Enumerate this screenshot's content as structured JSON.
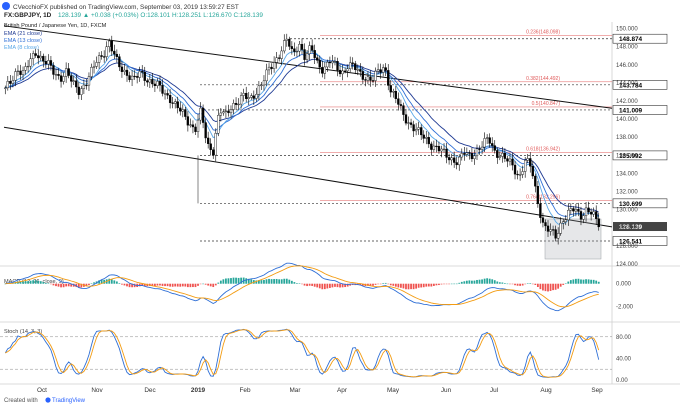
{
  "header": {
    "line1": "CVecchioFX published on TradingView.com, September 03, 2019 13:59:27 EST",
    "symbol": "FX:GBPJPY, 1D",
    "ohlc": "128.139 ▲ +0.038 (+0.03%) O:128.101 H:128.251 L:126.670 C:128.139"
  },
  "legend": {
    "title": "British Pound / Japanese Yen, 1D, FXCM",
    "ema1": "EMA (21 close)",
    "ema2": "EMA (13 close)",
    "ema3": "EMA (8 close)"
  },
  "footer": {
    "created_with": "Created with",
    "brand": "TradingView"
  },
  "colors": {
    "candle_up": "#ffffff",
    "candle_down": "#000000",
    "ema21": "#1f3a93",
    "ema13": "#2f6fd6",
    "ema8": "#5aa8e8",
    "fib_line": "#e05a5a",
    "macd_line": "#2f6fd6",
    "signal_line": "#f39c12",
    "hist_up": "#26a69a",
    "hist_down": "#ef5350",
    "stoch_k": "#2f6fd6",
    "stoch_d": "#f39c12"
  },
  "chart_data": {
    "type": "candlestick",
    "x_ticks": [
      "Oct",
      "Nov",
      "Dec",
      "2019",
      "Feb",
      "Mar",
      "Apr",
      "May",
      "Jun",
      "Jul",
      "Aug",
      "Sep"
    ],
    "price_axis": {
      "ylim": [
        124.0,
        150.5
      ],
      "ticks": [
        "150.000",
        "148.000",
        "146.000",
        "144.000",
        "142.000",
        "140.000",
        "138.000",
        "136.000",
        "134.000",
        "132.000",
        "130.000",
        "128.000",
        "126.000",
        "124.000"
      ]
    },
    "close_path": [
      143.2,
      144.3,
      145.6,
      145.0,
      146.3,
      147.5,
      146.6,
      146.0,
      145.1,
      144.6,
      145.2,
      143.9,
      143.2,
      143.8,
      145.0,
      146.5,
      147.3,
      148.4,
      146.6,
      145.6,
      145.0,
      144.2,
      145.1,
      144.6,
      144.0,
      143.6,
      142.9,
      142.3,
      141.3,
      140.6,
      139.7,
      138.8,
      140.8,
      137.1,
      136.6,
      141.0,
      140.3,
      141.5,
      142.0,
      142.5,
      142.1,
      143.1,
      144.0,
      145.3,
      146.3,
      147.5,
      148.8,
      147.0,
      148.5,
      146.8,
      147.8,
      146.2,
      145.5,
      146.4,
      145.8,
      145.1,
      146.0,
      145.7,
      145.0,
      144.6,
      144.3,
      145.2,
      145.8,
      143.2,
      142.0,
      140.5,
      139.6,
      138.9,
      138.2,
      137.6,
      137.0,
      136.6,
      136.0,
      135.6,
      135.3,
      136.2,
      135.9,
      136.5,
      137.1,
      137.8,
      136.5,
      136.0,
      135.4,
      134.8,
      133.6,
      135.4,
      134.6,
      131.0,
      128.2,
      127.6,
      127.0,
      128.8,
      129.6,
      130.0,
      129.3,
      130.1,
      129.5,
      128.1
    ],
    "emas": [
      {
        "name": "EMA (21 close)",
        "period": 21
      },
      {
        "name": "EMA (13 close)",
        "period": 13
      },
      {
        "name": "EMA (8 close)",
        "period": 8
      }
    ],
    "horizontal_levels": [
      {
        "value": 148.874,
        "label": "148.874",
        "fib": "0.236(148.098)"
      },
      {
        "value": 143.784,
        "label": "143.784",
        "fib": "0.382(144.492)"
      },
      {
        "value": 141.009,
        "label": "141.009",
        "fib": "0.5(140.847)"
      },
      {
        "value": 135.992,
        "label": "135.992",
        "fib": "0.618(136.942)"
      },
      {
        "value": 130.699,
        "label": "130.699",
        "fib": "0.764(132.296)"
      },
      {
        "value": 126.541,
        "label": "126.541",
        "fib": ""
      }
    ],
    "last_price_label": "128.139",
    "trendlines": [
      {
        "from": [
          0,
          150.3
        ],
        "to": [
          1,
          141.2
        ]
      },
      {
        "from": [
          0,
          139.1
        ],
        "to": [
          1,
          128.1
        ]
      }
    ],
    "macd": {
      "title": "MACD (12, 26, close, 9)",
      "ticks": [
        "0.000",
        "-2.000"
      ],
      "ylim": [
        -3.0,
        1.2
      ]
    },
    "stoch": {
      "title": "Stoch (14, 3, 3)",
      "ticks": [
        "80.00",
        "40.00",
        "0.00"
      ],
      "ylim": [
        0,
        100
      ],
      "levels": [
        80,
        20
      ]
    }
  }
}
